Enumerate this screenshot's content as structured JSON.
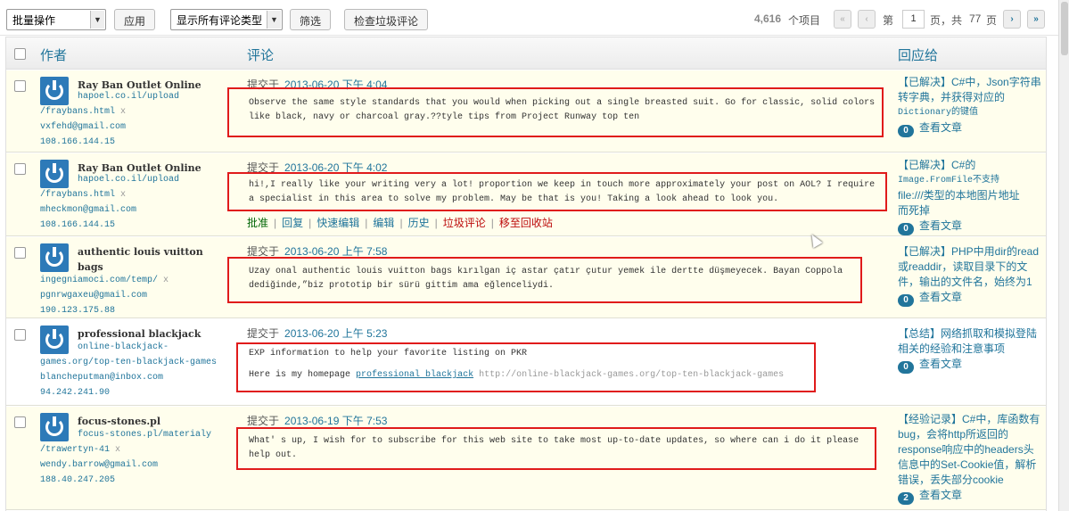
{
  "toolbar": {
    "bulk_action": "批量操作",
    "apply": "应用",
    "filter_type": "显示所有评论类型",
    "filter": "筛选",
    "check_spam": "检查垃圾评论"
  },
  "pagination": {
    "count": "4,616",
    "items_label": "个项目",
    "first": "«",
    "prev": "‹",
    "page_prefix": "第",
    "current_page": "1",
    "page_suffix": "页，共",
    "total_pages": "77",
    "pages_label": "页",
    "next": "›",
    "last": "»"
  },
  "columns": {
    "author": "作者",
    "comment": "评论",
    "response": "回应给"
  },
  "rows": [
    {
      "author_name": "Ray Ban Outlet Online",
      "url1": "hapoel.co.il/upload",
      "url2": "/fraybans.html",
      "x": "x",
      "email": "vxfehd@gmail.com",
      "ip": "108.166.144.15",
      "submitted": "提交于",
      "date": "2013-06-20 下午 4:04",
      "comment_lines": [
        "Observe the same style standards that you would when picking out a single breasted suit. Go for classic, solid colors",
        "like black, navy or charcoal gray.??tyle tips from Project Runway top ten"
      ],
      "response_lines": [
        "【已解决】C#中，Json字符串",
        "转字典，并获得对应的",
        "Dictionary的键值"
      ],
      "bubble": "0",
      "view": "查看文章"
    },
    {
      "author_name": "Ray Ban Outlet Online",
      "url1": "hapoel.co.il/upload",
      "url2": "/fraybans.html",
      "x": "x",
      "email": "mheckmon@gmail.com",
      "ip": "108.166.144.15",
      "submitted": "提交于",
      "date": "2013-06-20 下午 4:02",
      "comment_lines": [
        "hi!,I really like your writing very a lot! proportion we keep in touch more approximately your post on AOL? I require",
        "a specialist in this area to solve my problem. May be that is you! Taking a look ahead to look you."
      ],
      "actions": [
        "批准",
        "回复",
        "快速编辑",
        "编辑",
        "历史",
        "垃圾评论",
        "移至回收站"
      ],
      "response_lines": [
        "【已解决】C#的",
        "Image.FromFile不支持",
        "file:///类型的本地图片地址",
        "而死掉"
      ],
      "bubble": "0",
      "view": "查看文章"
    },
    {
      "author_name": "authentic louis vuitton bags",
      "url1": "ingegniamoci.com/temp/",
      "x": "x",
      "email": "pgnrwgaxeu@gmail.com",
      "ip": "190.123.175.88",
      "submitted": "提交于",
      "date": "2013-06-20 上午 7:58",
      "comment_lines": [
        "Uzay onal authentic louis vuitton bags kırılgan iç astar çatır çutur yemek ile dertte düşmeyecek. Bayan Coppola",
        "dediğinde,”biz prototip bir sürü gittim ama eğlenceliydi."
      ],
      "response_lines": [
        "【已解决】PHP中用dir的read",
        "或readdir，读取目录下的文",
        "件，输出的文件名，始终为1"
      ],
      "bubble": "0",
      "view": "查看文章"
    },
    {
      "author_name": "professional blackjack",
      "url1": "online-blackjack-",
      "url2": "games.org/top-ten-blackjack-games",
      "x": "x",
      "email": "blancheputman@inbox.com",
      "ip": "94.242.241.90",
      "submitted": "提交于",
      "date": "2013-06-20 上午 5:23",
      "comment_line1": "EXP information to help your favorite listing on PKR",
      "comment_prefix": "Here is my homepage",
      "comment_link": "professional blackjack",
      "comment_url": "http://online-blackjack-games.org/top-ten-blackjack-games",
      "response_lines": [
        "【总结】网络抓取和模拟登陆",
        "相关的经验和注意事项"
      ],
      "bubble": "0",
      "view": "查看文章"
    },
    {
      "author_name": "focus-stones.pl",
      "url1": "focus-stones.pl/materialy",
      "url2": "/trawertyn-41",
      "x": "x",
      "email": "wendy.barrow@gmail.com",
      "ip": "188.40.247.205",
      "submitted": "提交于",
      "date": "2013-06-19 下午 7:53",
      "comment_lines": [
        "What' s up, I wish for to subscribe for this web site to take most up-to-date updates, so where can i do it please",
        "help out."
      ],
      "response_lines": [
        "【经验记录】C#中，库函数有",
        "bug，会将http所返回的",
        "response响应中的headers头",
        "信息中的Set-Cookie值，解析",
        "错误，丢失部分cookie"
      ],
      "bubble": "2",
      "view": "查看文章"
    }
  ]
}
